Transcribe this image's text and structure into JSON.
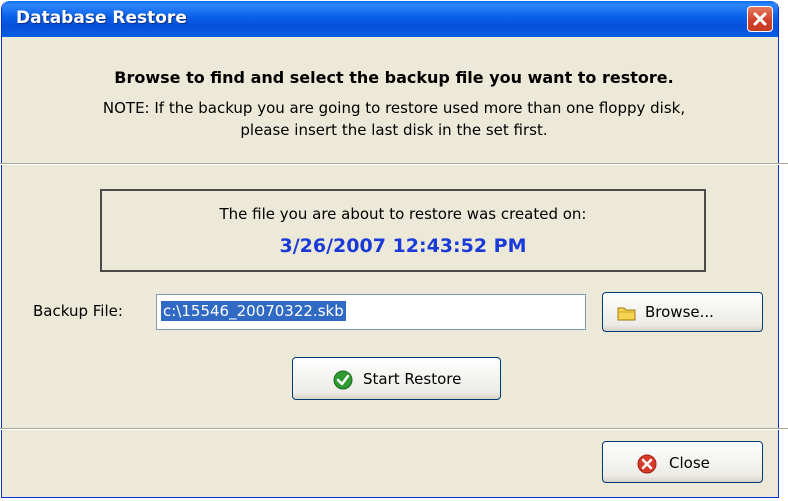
{
  "window": {
    "title": "Database Restore"
  },
  "instructions": {
    "heading": "Browse to find and select the backup file you want to restore.",
    "note_line1": "NOTE: If the backup you are going to restore used more than one floppy disk,",
    "note_line2": "please insert the last disk in the set first."
  },
  "info": {
    "label": "The file you are about to restore was created on:",
    "created_on": "3/26/2007 12:43:52 PM"
  },
  "backup": {
    "label": "Backup File:",
    "file_value": "c:\\15546_20070322.skb"
  },
  "buttons": {
    "browse_label": "Browse...",
    "start_restore_label": "Start Restore",
    "close_label": "Close"
  },
  "icons": {
    "window_close": "close-icon",
    "browse": "folder-icon",
    "start_restore": "checkmark-icon",
    "close": "cancel-icon"
  },
  "colors": {
    "titlebar": "#0a5fe8",
    "date_text": "#1a3ad8",
    "selection": "#316ac5",
    "dialog_bg": "#ece9d8"
  }
}
